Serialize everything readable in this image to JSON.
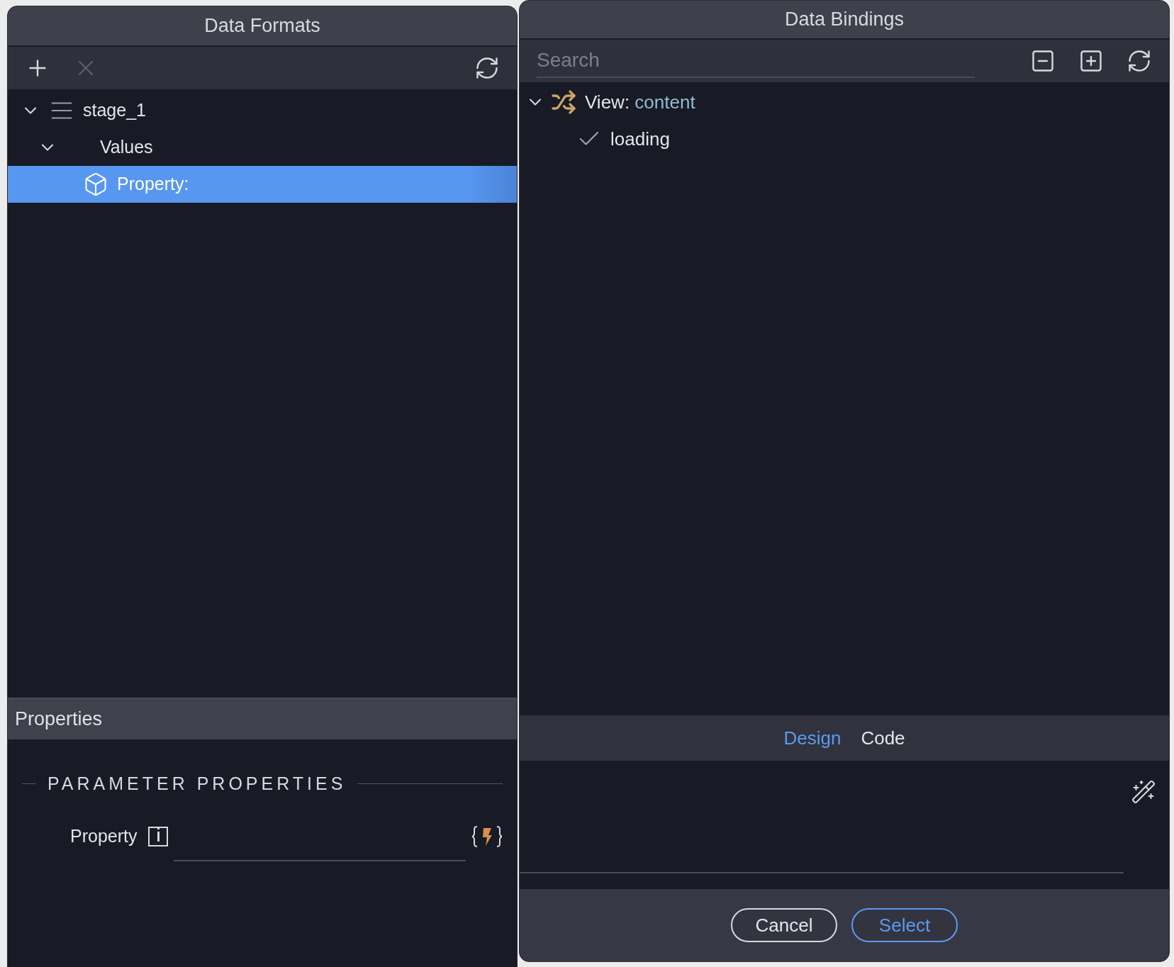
{
  "left_panel": {
    "title": "Data Formats",
    "toolbar": [
      {
        "kind": "add",
        "disabled": false
      },
      {
        "kind": "delete",
        "disabled": true
      },
      {
        "kind": "refresh",
        "disabled": false
      }
    ],
    "tree": [
      {
        "label": "stage_1",
        "kind": "list",
        "expanded": true,
        "selected": false,
        "children": [
          {
            "label": "Values",
            "expanded": true,
            "selected": false,
            "children": [
              {
                "label": "Property:",
                "kind": "cube",
                "selected": true
              }
            ]
          }
        ]
      }
    ],
    "properties": {
      "title": "Properties",
      "section": "PARAMETER PROPERTIES",
      "fields": [
        {
          "label": "Property"
        }
      ]
    }
  },
  "right_panel": {
    "title": "Data Bindings",
    "search": {
      "placeholder": "Search"
    },
    "toolbar": [
      {
        "kind": "collapse"
      },
      {
        "kind": "expand"
      },
      {
        "kind": "refresh"
      }
    ],
    "tree": [
      {
        "prefix": "View:",
        "label": "content",
        "kind": "view",
        "expanded": true,
        "children": [
          {
            "label": "loading",
            "kind": "check",
            "checked": true
          }
        ]
      }
    ],
    "tabs": [
      {
        "label": "Design",
        "selected": true
      },
      {
        "label": "Code",
        "selected": false
      }
    ],
    "buttons": [
      {
        "label": "Cancel",
        "kind": "secondary"
      },
      {
        "label": "Select",
        "kind": "primary"
      }
    ]
  }
}
